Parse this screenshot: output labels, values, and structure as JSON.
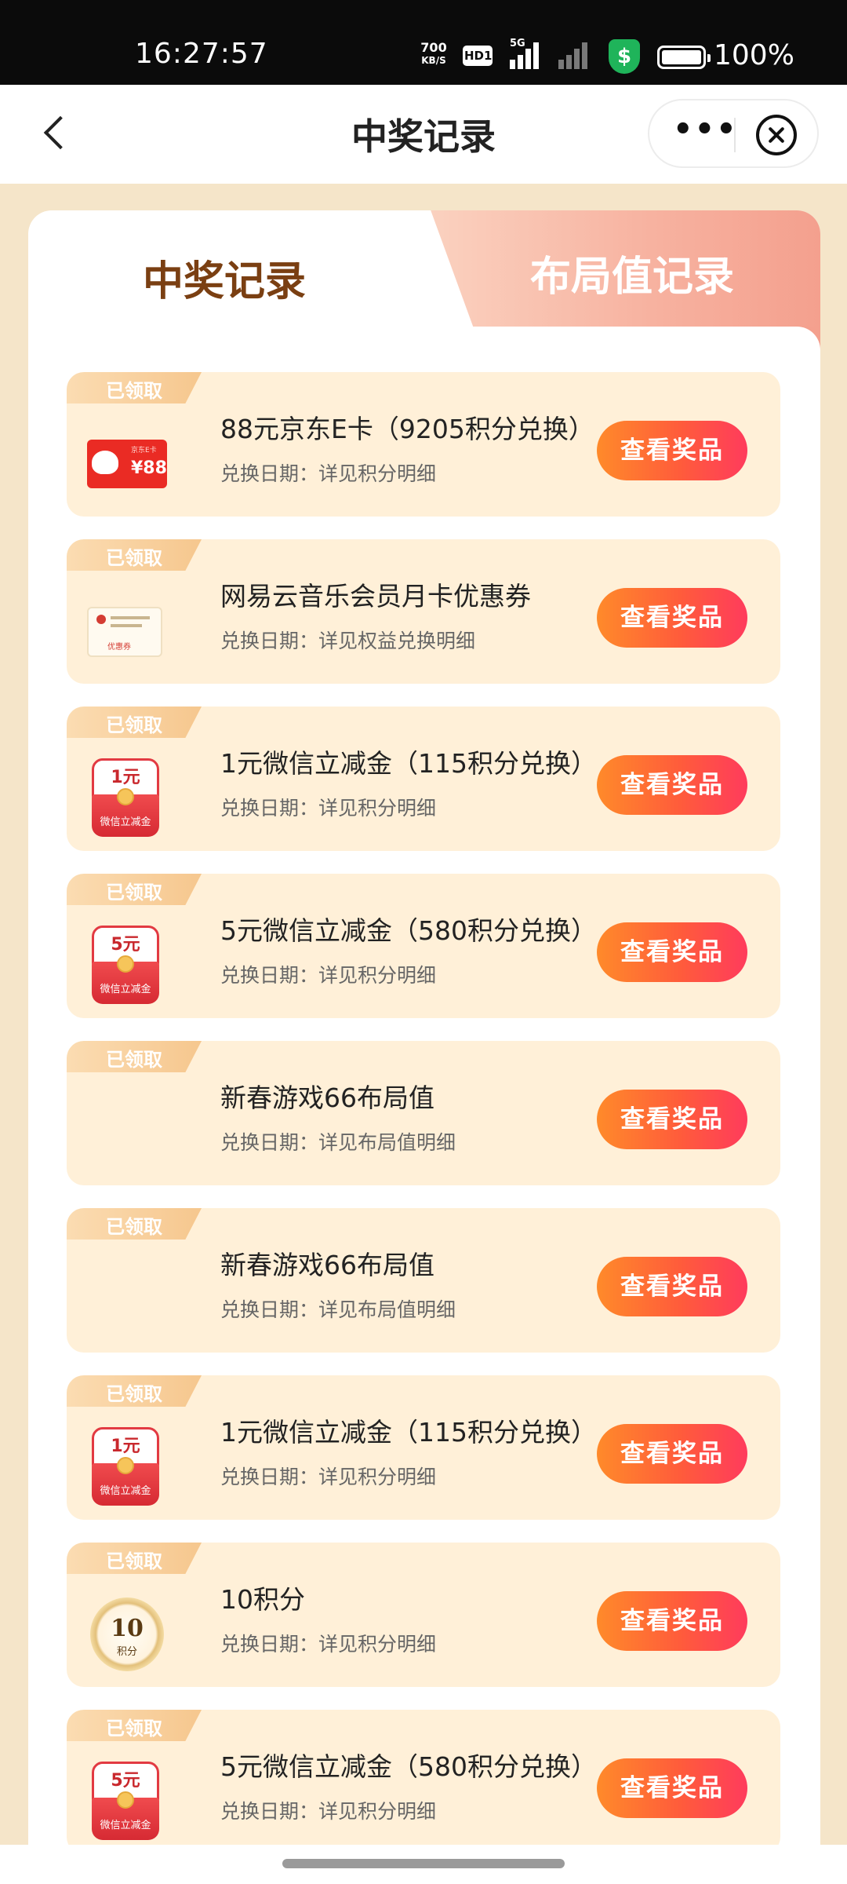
{
  "status": {
    "time": "16:27:57",
    "net_speed": "700",
    "net_unit": "KB/S",
    "hd": "HD1",
    "net_type": "5G",
    "battery": "100%"
  },
  "nav": {
    "title": "中奖记录"
  },
  "tabs": {
    "active": "中奖记录",
    "inactive": "布局值记录"
  },
  "badge_label": "已领取",
  "button_label": "查看奖品",
  "items": [
    {
      "name": "88元京东E卡（9205积分兑换）",
      "date": "兑换日期：详见积分明细",
      "thumb": "jd-card",
      "thumb_text": "¥88",
      "thumb_sub": "京东E卡"
    },
    {
      "name": "网易云音乐会员月卡优惠券",
      "date": "兑换日期：详见权益兑换明细",
      "thumb": "netease-coupon",
      "thumb_text": "优惠券"
    },
    {
      "name": "1元微信立减金（115积分兑换）",
      "date": "兑换日期：详见积分明细",
      "thumb": "red-packet",
      "thumb_text": "1元",
      "thumb_sub": "微信立减金"
    },
    {
      "name": "5元微信立减金（580积分兑换）",
      "date": "兑换日期：详见积分明细",
      "thumb": "red-packet",
      "thumb_text": "5元",
      "thumb_sub": "微信立减金"
    },
    {
      "name": "新春游戏66布局值",
      "date": "兑换日期：详见布局值明细",
      "thumb": "none"
    },
    {
      "name": "新春游戏66布局值",
      "date": "兑换日期：详见布局值明细",
      "thumb": "none"
    },
    {
      "name": "1元微信立减金（115积分兑换）",
      "date": "兑换日期：详见积分明细",
      "thumb": "red-packet",
      "thumb_text": "1元",
      "thumb_sub": "微信立减金"
    },
    {
      "name": "10积分",
      "date": "兑换日期：详见积分明细",
      "thumb": "points-coin",
      "thumb_text": "10",
      "thumb_sub": "积分"
    },
    {
      "name": "5元微信立减金（580积分兑换）",
      "date": "兑换日期：详见积分明细",
      "thumb": "red-packet",
      "thumb_text": "5元",
      "thumb_sub": "微信立减金"
    }
  ]
}
